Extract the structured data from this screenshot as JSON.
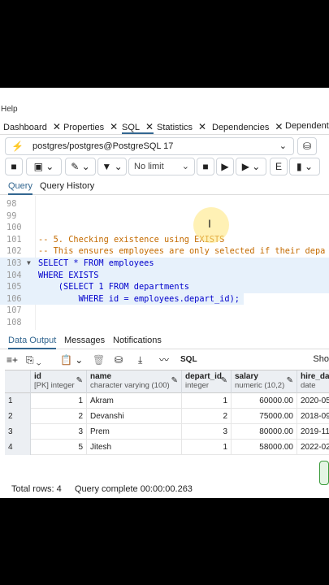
{
  "menu": {
    "help": "Help"
  },
  "tabs": [
    {
      "label": "Dashboard",
      "close": "✕"
    },
    {
      "label": "Properties",
      "close": "✕"
    },
    {
      "label": "SQL",
      "close": "✕"
    },
    {
      "label": "Statistics",
      "close": "✕"
    },
    {
      "label": "Dependencies",
      "close": "✕"
    },
    {
      "label": "Dependents",
      "close": ""
    }
  ],
  "connection": {
    "label": "postgres/postgres@PostgreSQL 17"
  },
  "toolbar": {
    "limit": "No limit"
  },
  "query_tabs": {
    "query": "Query",
    "history": "Query History"
  },
  "editor": {
    "lines": [
      {
        "n": "98",
        "text": ""
      },
      {
        "n": "99",
        "text": ""
      },
      {
        "n": "100",
        "text": ""
      },
      {
        "n": "101",
        "text": "-- 5. Checking existence using EXISTS"
      },
      {
        "n": "102",
        "text": "-- This ensures employees are only selected if their depa"
      },
      {
        "n": "103",
        "text": "SELECT * FROM employees"
      },
      {
        "n": "104",
        "text": "WHERE EXISTS"
      },
      {
        "n": "105",
        "text": "    (SELECT 1 FROM departments"
      },
      {
        "n": "106",
        "text": "        WHERE id = employees.depart_id);"
      },
      {
        "n": "107",
        "text": ""
      },
      {
        "n": "108",
        "text": ""
      }
    ]
  },
  "output_tabs": {
    "data": "Data Output",
    "messages": "Messages",
    "notifications": "Notifications"
  },
  "grid_toolbar": {
    "sql": "SQL",
    "show": "Sho"
  },
  "grid": {
    "columns": [
      {
        "name": "id",
        "type": "[PK] integer"
      },
      {
        "name": "name",
        "type": "character varying (100)"
      },
      {
        "name": "depart_id",
        "type": "integer"
      },
      {
        "name": "salary",
        "type": "numeric (10,2)"
      },
      {
        "name": "hire_date",
        "type": "date"
      }
    ],
    "rows": [
      {
        "rn": "1",
        "id": "1",
        "name": "Akram",
        "depart_id": "1",
        "salary": "60000.00",
        "hire_date": "2020-05"
      },
      {
        "rn": "2",
        "id": "2",
        "name": "Devanshi",
        "depart_id": "2",
        "salary": "75000.00",
        "hire_date": "2018-09"
      },
      {
        "rn": "3",
        "id": "3",
        "name": "Prem",
        "depart_id": "3",
        "salary": "80000.00",
        "hire_date": "2019-11"
      },
      {
        "rn": "4",
        "id": "5",
        "name": "Jitesh",
        "depart_id": "1",
        "salary": "58000.00",
        "hire_date": "2022-02"
      }
    ]
  },
  "status": {
    "total": "Total rows: 4",
    "complete": "Query complete 00:00:00.263"
  },
  "colors": {
    "accent": "#326690",
    "highlight": "#e7f1fb"
  }
}
